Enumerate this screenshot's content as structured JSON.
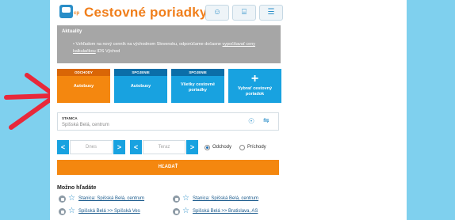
{
  "header": {
    "title": "Cestovné poriadky",
    "logo_sub": "cp",
    "buttons": [
      {
        "icon": "user-icon",
        "glyph": "☺"
      },
      {
        "icon": "bus-icon",
        "glyph": "⌸"
      },
      {
        "icon": "menu-icon",
        "glyph": "☰"
      }
    ]
  },
  "news": {
    "title": "Aktuality",
    "text": "Vzhľadom na nový cenník na východnom Slovensku, odporúčame dočasne",
    "link": "vypočítavať ceny kalkulačkou",
    "text_tail": "IDS Východ"
  },
  "tiles": [
    {
      "bar": "ODCHODY",
      "label": "Autobusy",
      "active": true
    },
    {
      "bar": "SPOJENIE",
      "label": "Autobusy",
      "active": false
    },
    {
      "bar": "SPOJENIE",
      "label": "Všetky cestovné poriadky",
      "active": false
    },
    {
      "plus": "+",
      "label": "Vybrať cestovný poriadok",
      "active": false
    }
  ],
  "station": {
    "label": "STANICA",
    "value": "Spišská Belá, centrum"
  },
  "date": {
    "prev": "<",
    "placeholder": "Dnes",
    "next": ">"
  },
  "time": {
    "prev": "<",
    "placeholder": "Teraz",
    "next": ">"
  },
  "direction": {
    "options": [
      {
        "label": "Odchody",
        "checked": true
      },
      {
        "label": "Príchody",
        "checked": false
      }
    ]
  },
  "search_button": "HĽADAŤ",
  "suggestions": {
    "title": "Možno hľadáte",
    "items": [
      "Stanica: Spišská Belá, centrum",
      "Stanica: Spišská Belá, centrum",
      "Spišská Belá >> Spišská Ves",
      "Spišská Belá >> Bratislava, AS"
    ]
  },
  "colors": {
    "accent": "#f4870f",
    "primary": "#18a2e0",
    "pointer": "#e8283a",
    "backdrop": "#7fd0ee"
  }
}
